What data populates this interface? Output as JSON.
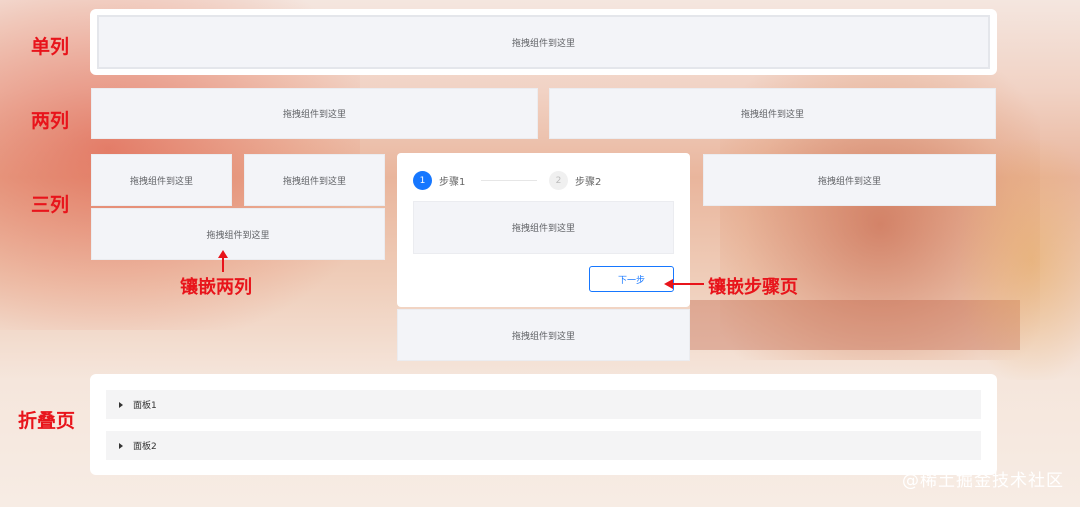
{
  "labels": {
    "single_column": "单列",
    "two_column": "两列",
    "three_column": "三列",
    "collapse_page": "折叠页",
    "nested_two_column": "镶嵌两列",
    "nested_steps_page": "镶嵌步骤页"
  },
  "drop_placeholder": "拖拽组件到这里",
  "steps": [
    {
      "index": "1",
      "label": "步骤1",
      "status": "active"
    },
    {
      "index": "2",
      "label": "步骤2",
      "status": "waiting"
    }
  ],
  "next_button": "下一步",
  "panels": [
    "面板1",
    "面板2"
  ],
  "watermark": "@稀土掘金技术社区",
  "colors": {
    "accent": "#1677ff",
    "annotation": "#e8141b"
  }
}
